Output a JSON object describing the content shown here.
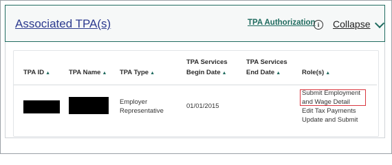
{
  "section": {
    "title": "Associated TPA(s)",
    "auth_link": "TPA Authorization",
    "info_icon": "info-icon",
    "info_glyph": "i",
    "collapse_label": "Collapse",
    "chevron_icon": "chevron-down-icon",
    "accent_color": "#1f6b5f",
    "title_color": "#2c3a8f"
  },
  "table": {
    "columns": [
      {
        "label": "TPA ID",
        "sort_icon": "sort-ascending-icon",
        "sort_glyph": "▲"
      },
      {
        "label": "TPA Name",
        "sort_icon": "sort-ascending-icon",
        "sort_glyph": "▲"
      },
      {
        "label": "TPA Type",
        "sort_icon": "sort-ascending-icon",
        "sort_glyph": "▲"
      },
      {
        "label_line1": "TPA Services",
        "label_line2": "Begin Date",
        "sort_icon": "sort-ascending-icon",
        "sort_glyph": "▲"
      },
      {
        "label_line1": "TPA Services",
        "label_line2": "End Date",
        "sort_icon": "sort-ascending-icon",
        "sort_glyph": "▲"
      },
      {
        "label": "Role(s)",
        "sort_icon": "sort-ascending-icon",
        "sort_glyph": "▲"
      }
    ],
    "rows": [
      {
        "tpa_id": "",
        "tpa_name": "",
        "tpa_type_line1": "Employer",
        "tpa_type_line2": "Representative",
        "begin_date": "01/01/2015",
        "end_date": "",
        "roles": [
          {
            "line1": "Submit Employment",
            "line2": "and Wage Detail"
          },
          {
            "line1": "Edit Tax Payments"
          },
          {
            "line1": "Update and Submit"
          }
        ]
      }
    ]
  }
}
